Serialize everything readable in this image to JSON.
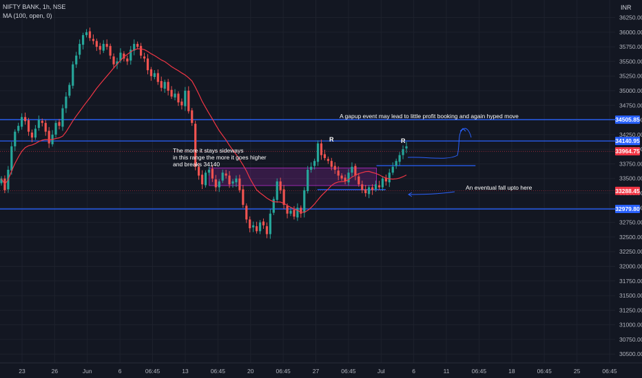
{
  "header": {
    "symbol_line": "NIFTY BANK, 1h, NSE",
    "indicator_line": "MA (100, open, 0)",
    "currency": "INR"
  },
  "annotations": {
    "sideways_note": [
      "The more it stays sideways",
      "in this range the more it goes higher",
      "and breaks 34140"
    ],
    "gapup_note": "A gapup event may lead to little profit booking and again hyped move",
    "fall_note": "An eventual fall upto here",
    "resistance_marks": [
      "R",
      "R"
    ]
  },
  "colors": {
    "background": "#131722",
    "up": "#26a69a",
    "down": "#ef5350",
    "ma": "#f23645",
    "level_line": "#2962ff",
    "range_box": "#9c27b0",
    "grid": "#1e222d",
    "text": "#d1d4dc"
  },
  "chart_data": {
    "type": "candlestick",
    "title": "NIFTY BANK, 1h, NSE",
    "ylim": [
      30350,
      36550
    ],
    "y_ticks": [
      "36250.00",
      "36000.00",
      "35750.00",
      "35500.00",
      "35250.00",
      "35000.00",
      "34750.00",
      "34500.00",
      "34250.00",
      "34000.00",
      "33750.00",
      "33500.00",
      "33250.00",
      "33000.00",
      "32750.00",
      "32500.00",
      "32250.00",
      "32000.00",
      "31750.00",
      "31500.00",
      "31250.00",
      "31000.00",
      "30750.00",
      "30500.00"
    ],
    "x_ticks": [
      "23",
      "26",
      "Jun",
      "6",
      "06:45",
      "13",
      "06:45",
      "20",
      "06:45",
      "27",
      "06:45",
      "Jul",
      "6",
      "11",
      "06:45",
      "18",
      "06:45",
      "25",
      "06:45"
    ],
    "horizontal_levels": [
      {
        "price": 34505.85,
        "label": "34505.85",
        "label_color": "#2962ff"
      },
      {
        "price": 34140.95,
        "label": "34140.95",
        "label_color": "#2962ff"
      },
      {
        "price": 33964.75,
        "label": "33964.75",
        "label_color": "#f23645"
      },
      {
        "price": 33288.45,
        "label": "33288.45",
        "label_color": "#f23645"
      },
      {
        "price": 32979.8,
        "label": "32979.80",
        "label_color": "#2962ff"
      }
    ],
    "range_box": {
      "from_bar": 0.34,
      "to_bar": 0.612,
      "top": 33680,
      "bottom": 33380
    },
    "short_levels": [
      {
        "price": 33720,
        "from": 0.612,
        "to": 0.773
      },
      {
        "price": 33310,
        "from": 0.516,
        "to": 0.627
      }
    ],
    "series_close": [
      33500,
      33300,
      33650,
      34050,
      34300,
      34400,
      34550,
      34480,
      34300,
      34200,
      34350,
      34500,
      34450,
      34300,
      34100,
      34250,
      34450,
      34400,
      34700,
      34900,
      35100,
      35450,
      35600,
      35800,
      35950,
      36000,
      35900,
      35850,
      35750,
      35700,
      35800,
      35750,
      35600,
      35450,
      35500,
      35650,
      35550,
      35500,
      35700,
      35800,
      35750,
      35600,
      35550,
      35350,
      35250,
      35300,
      35150,
      35050,
      35150,
      35000,
      34900,
      34950,
      34800,
      34750,
      35000,
      34650,
      34450,
      33700,
      33550,
      33400,
      33600,
      33650,
      33500,
      33350,
      33450,
      33600,
      33550,
      33400,
      33450,
      33500,
      33300,
      33050,
      32800,
      32650,
      32700,
      32600,
      32750,
      32700,
      32550,
      32900,
      33150,
      33450,
      33300,
      33050,
      32900,
      32950,
      32850,
      33000,
      32900,
      33300,
      33650,
      33700,
      33800,
      34100,
      33900,
      33850,
      33800,
      33700,
      33650,
      33550,
      33500,
      33450,
      33600,
      33700,
      33550,
      33400,
      33300,
      33250,
      33350,
      33300,
      33400,
      33350,
      33500,
      33450,
      33600,
      33700,
      33800,
      33900,
      34000,
      34050
    ]
  }
}
